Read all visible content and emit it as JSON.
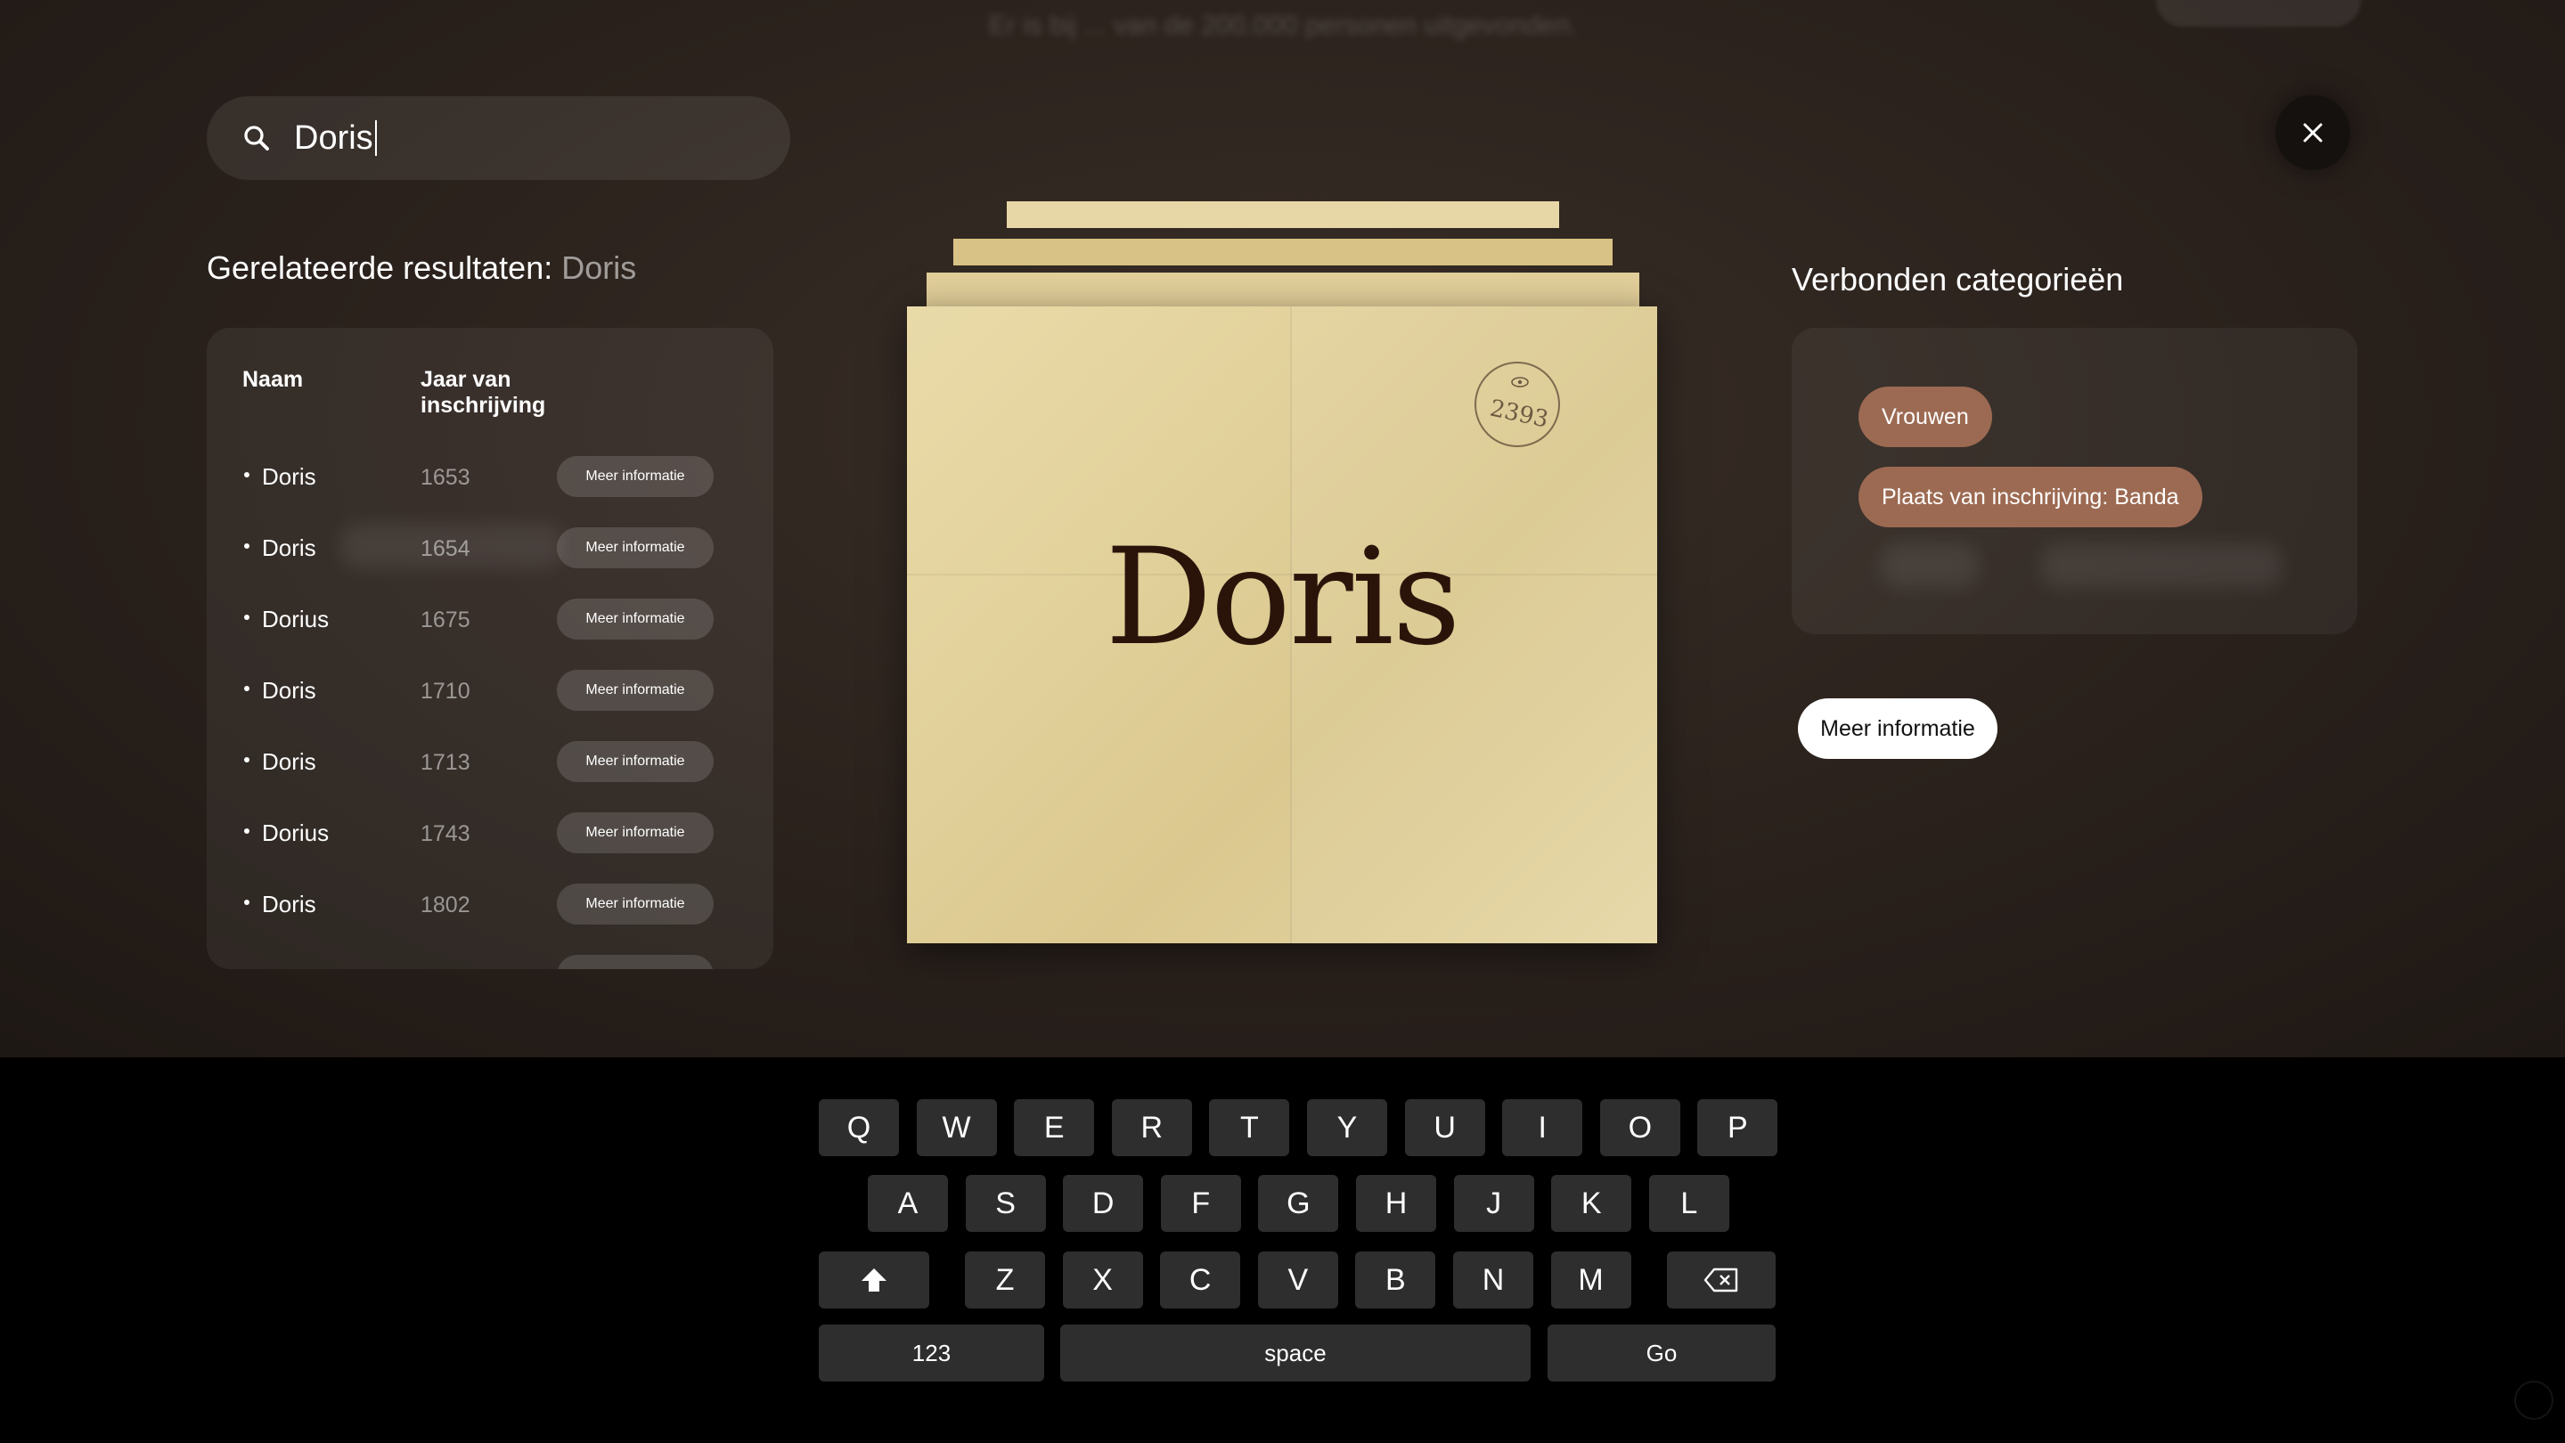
{
  "header": {
    "blurred_line": "Er is bij ... van de 200.000 personen uitgevonden."
  },
  "search": {
    "value": "Doris",
    "icon": "search-icon"
  },
  "close": {
    "icon": "close-icon"
  },
  "results": {
    "title_prefix": "Gerelateerde resultaten: ",
    "title_query": "Doris",
    "col_name": "Naam",
    "col_year": "Jaar van inschrijving",
    "rows": [
      {
        "name": "Doris",
        "year": "1653",
        "button": "Meer informatie"
      },
      {
        "name": "Doris",
        "year": "1654",
        "button": "Meer informatie"
      },
      {
        "name": "Dorius",
        "year": "1675",
        "button": "Meer informatie"
      },
      {
        "name": "Doris",
        "year": "1710",
        "button": "Meer informatie"
      },
      {
        "name": "Doris",
        "year": "1713",
        "button": "Meer informatie"
      },
      {
        "name": "Dorius",
        "year": "1743",
        "button": "Meer informatie"
      },
      {
        "name": "Doris",
        "year": "1802",
        "button": "Meer informatie"
      }
    ]
  },
  "card": {
    "name": "Doris",
    "stamp_number": "2393",
    "stamp_icon": "eye-icon"
  },
  "categories": {
    "title": "Verbonden categorieën",
    "chips": [
      "Vrouwen",
      "Plaats van inschrijving: Banda"
    ],
    "more_info": "Meer informatie"
  },
  "keyboard": {
    "row1": [
      "Q",
      "W",
      "E",
      "R",
      "T",
      "Y",
      "U",
      "I",
      "O",
      "P"
    ],
    "row2": [
      "A",
      "S",
      "D",
      "F",
      "G",
      "H",
      "J",
      "K",
      "L"
    ],
    "row3": [
      "Z",
      "X",
      "C",
      "V",
      "B",
      "N",
      "M"
    ],
    "shift_icon": "shift-icon",
    "backspace_icon": "backspace-icon",
    "numbers": "123",
    "space": "space",
    "go": "Go"
  },
  "colors": {
    "chip": "#9c6a52",
    "card_paper": "#e3d29c",
    "card_text": "#2a140a"
  }
}
